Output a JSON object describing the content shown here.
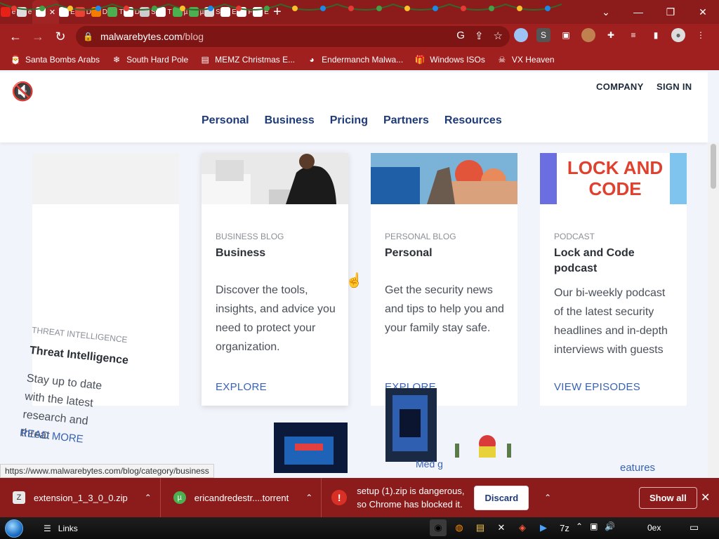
{
  "browser": {
    "tabs": [
      {
        "icon": "youtube-icon",
        "letter": "e",
        "color": "#e62117"
      },
      {
        "icon": "chrome-icon",
        "letter": "e",
        "color": "#dddddd"
      },
      {
        "icon": "speaker-icon",
        "letter": "",
        "color": "#ffffff",
        "active": true
      },
      {
        "icon": "museum-icon",
        "letter": "E",
        "color": "#ffffff"
      },
      {
        "icon": "gmail-icon",
        "letter": "D",
        "color": "#ea4335"
      },
      {
        "icon": "x-icon",
        "letter": "D",
        "color": "#f57c00"
      },
      {
        "icon": "utorrent-icon",
        "letter": "T",
        "color": "#4caf50"
      },
      {
        "icon": "download-icon",
        "letter": "D",
        "color": "#ffffff"
      },
      {
        "icon": "image-icon",
        "letter": "S",
        "color": "#cccccc"
      },
      {
        "icon": "page-icon",
        "letter": "T",
        "color": "#ffffff"
      },
      {
        "icon": "utorrent-icon",
        "letter": "µ",
        "color": "#4caf50"
      },
      {
        "icon": "utorrent-icon",
        "letter": "µ",
        "color": "#4caf50"
      },
      {
        "icon": "chrome-icon",
        "letter": "S",
        "color": "#dddddd"
      },
      {
        "icon": "puzzle-icon",
        "letter": "E",
        "color": "#ffffff"
      },
      {
        "icon": "history-icon",
        "letter": "F",
        "color": "#ffffff"
      },
      {
        "icon": "museum-icon",
        "letter": "E",
        "color": "#ffffff"
      }
    ],
    "url_host": "malwarebytes.com",
    "url_path": "/blog",
    "bookmarks": [
      {
        "label": "Santa Bombs Arabs",
        "icon": "santa-icon"
      },
      {
        "label": "South Hard Pole",
        "icon": "snowflake-icon"
      },
      {
        "label": "MEMZ Christmas E...",
        "icon": "page-icon"
      },
      {
        "label": "Endermanch Malwa...",
        "icon": "raccoon-icon"
      },
      {
        "label": "Windows ISOs",
        "icon": "gift-icon"
      },
      {
        "label": "VX Heaven",
        "icon": "skull-icon"
      }
    ]
  },
  "site": {
    "top_links": [
      "COMPANY",
      "SIGN IN"
    ],
    "nav": [
      "Personal",
      "Business",
      "Pricing",
      "Partners",
      "Resources"
    ]
  },
  "cards": [
    {
      "category": "BUSINESS BLOG",
      "title": "Business",
      "description": "Discover the tools, insights, and advice you need to protect your organization.",
      "cta": "EXPLORE"
    },
    {
      "category": "PERSONAL BLOG",
      "title": "Personal",
      "description": "Get the security news and tips to help you and your family stay safe.",
      "cta": "EXPLORE"
    },
    {
      "category": "PODCAST",
      "title": "Lock and Code podcast",
      "description": "Our bi-weekly podcast of the latest security headlines and in-depth interviews with guests",
      "cta": "VIEW EPISODES",
      "image_text_top": "LOCK AND",
      "image_text_bottom": "CODE"
    }
  ],
  "glitch_card": {
    "category": "THREAT INTELLIGENCE",
    "title": "Threat Intelligence",
    "description": "Stay up to date with the latest research and threat",
    "cta": "READ MORE"
  },
  "fragments": {
    "bottom_text": "eatures",
    "bottom_mid": "Med g"
  },
  "status_url": "https://www.malwarebytes.com/blog/category/business",
  "downloads": {
    "items": [
      {
        "name": "extension_1_3_0_0.zip",
        "icon": "zip-icon"
      },
      {
        "name": "ericandredestr....torrent",
        "icon": "utorrent-icon"
      }
    ],
    "warning_line1": "setup (1).zip is dangerous,",
    "warning_line2": "so Chrome has blocked it.",
    "discard_label": "Discard",
    "show_all_label": "Show all"
  },
  "taskbar": {
    "links_label": "Links",
    "time": "0ex"
  }
}
